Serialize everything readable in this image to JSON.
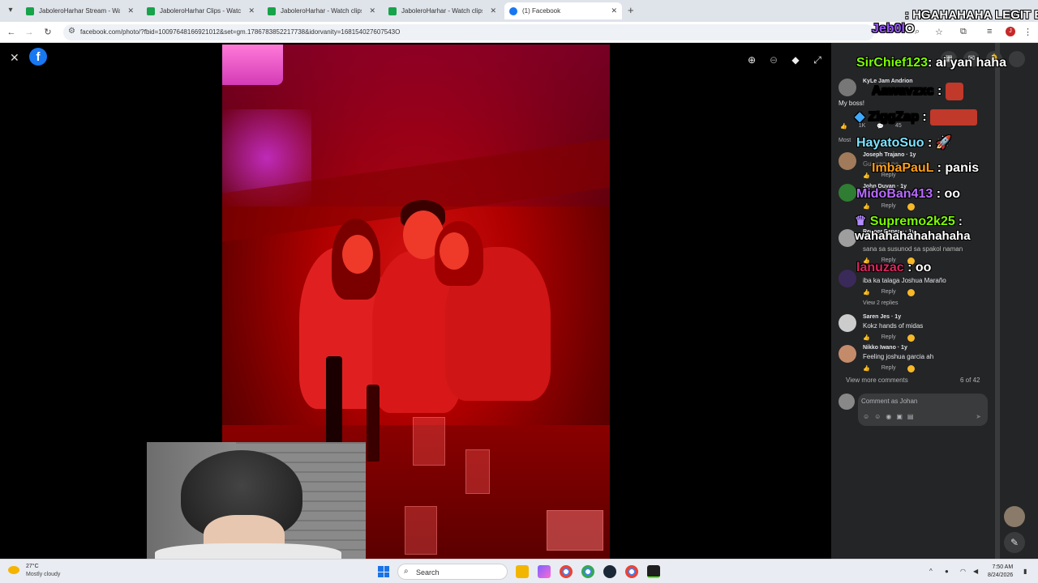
{
  "browser": {
    "tabs": [
      {
        "title": "JaboleroHarhar Stream - Watch",
        "active": false
      },
      {
        "title": "JaboleroHarhar Clips - Watch L",
        "active": false
      },
      {
        "title": "JaboleroHarhar - Watch clips or",
        "active": false
      },
      {
        "title": "JaboleroHarhar - Watch clips or",
        "active": false
      },
      {
        "title": "(1) Facebook",
        "active": true
      }
    ],
    "url": "facebook.com/photo/?fbid=10097648166921012&set=gm.1786783852217738&idorvanity=168154027607543O",
    "profile_initial": "J"
  },
  "comments_panel": {
    "top_comment": {
      "name": "KyLe Jam Andrion",
      "text": "My boss!",
      "likes": "1K",
      "replies": "45"
    },
    "sort_label": "Most",
    "comments": [
      {
        "name": "Joseph Trajano · 1y",
        "text": "Guuuapo na",
        "reply": "Reply"
      },
      {
        "name": "John Duyan · 1y",
        "text": "",
        "reply": "Reply"
      },
      {
        "name": "Regner Peneza · 1y",
        "text": "sana sa susunod sa spakol naman",
        "reply": "Reply"
      },
      {
        "name": "",
        "text": "iba ka talaga Joshua Maraño",
        "reply": "Reply"
      },
      {
        "name": "Saren Jes · 1y",
        "text": "Kokz hands of midas",
        "reply": "Reply"
      },
      {
        "name": "Nikko Iwano · 1y",
        "text": "Feeling joshua garcia ah",
        "reply": "Reply"
      }
    ],
    "view_replies": "View 2 replies",
    "view_more": "View more comments",
    "count": "6 of 42",
    "composer_placeholder": "Comment as Johan"
  },
  "stream_chat": [
    {
      "user": "Jeb0l",
      "message": ": HGAHAHAHA LEGIT B O",
      "color": "#9b59ff"
    },
    {
      "user": "SirChief123",
      "message": ": ai yan haha",
      "color": "#7cfc00"
    },
    {
      "user": "Aawavzxc",
      "message": " :",
      "color": "#ffffff"
    },
    {
      "user": "ZiggZap",
      "message": " :",
      "color": "#ffffff"
    },
    {
      "user": "HayatoSuo",
      "message": " :",
      "color": "#7de3ff"
    },
    {
      "user": "ImbaPauL",
      "message": " : panis",
      "color": "#ff9f1a"
    },
    {
      "user": "MidoBan413",
      "message": " : oo",
      "color": "#b86bff"
    },
    {
      "user": "Supremo2k25",
      "message": " : wahahahahahahaha",
      "color": "#7cfc00"
    },
    {
      "user": "lanuzac",
      "message": " : oo",
      "color": "#e0245e"
    }
  ],
  "taskbar": {
    "weather_temp": "27°C",
    "weather_desc": "Mostly cloudy",
    "search_label": "Search",
    "time": "7:50 AM",
    "date": "8/24/2026"
  }
}
